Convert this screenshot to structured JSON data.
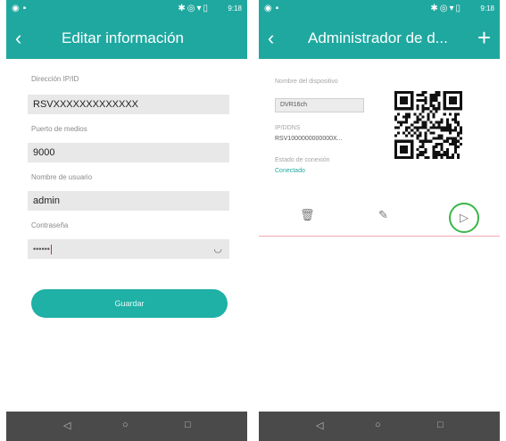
{
  "status_bar": {
    "time": "9:18"
  },
  "left": {
    "title": "Editar información",
    "fields": [
      {
        "label": "Dirección IP/ID",
        "value": "RSVXXXXXXXXXXXXX"
      },
      {
        "label": "Puerto de medios",
        "value": "9000"
      },
      {
        "label": "Nombre de usuario",
        "value": "admin"
      },
      {
        "label": "Contraseña",
        "value": "••••••"
      }
    ],
    "save_label": "Guardar"
  },
  "right": {
    "title": "Administrador de d...",
    "add_label": "+",
    "device_name_label": "Nombre del dispositivo",
    "device_name_value": "DVR16ch",
    "ipid_label": "IP/DDNS",
    "ipid_value": "RSV1000000000000X...",
    "status_label": "Estado de conexión",
    "status_value": "Conectado"
  },
  "icons": {
    "back": "‹",
    "trash": "🗑",
    "edit": "✎",
    "play": "▷",
    "eye": "◡",
    "nav_back": "◁",
    "nav_home": "○",
    "nav_recent": "□"
  },
  "colors": {
    "accent": "#1fa8a0",
    "highlight_ring": "#3ab54a",
    "divider": "#f4a8b6"
  }
}
